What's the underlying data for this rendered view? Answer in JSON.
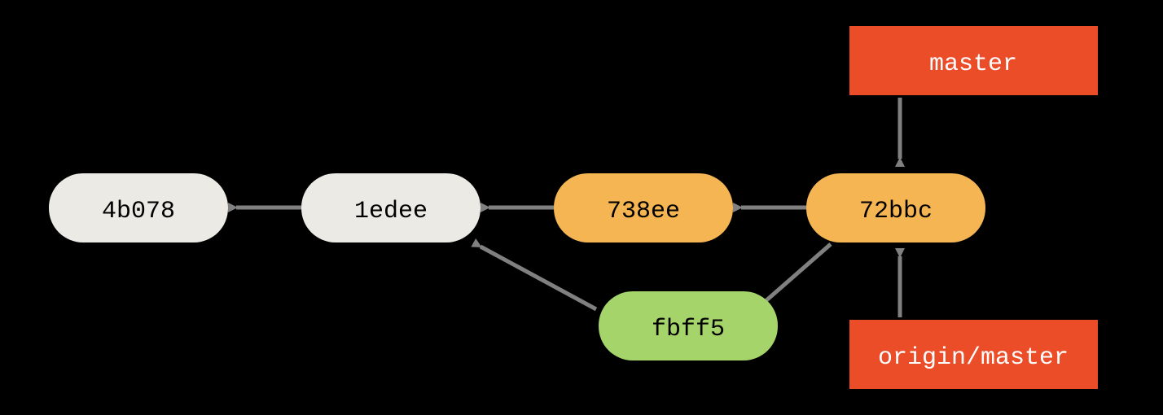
{
  "colors": {
    "commit_old": "#ECEAE4",
    "commit_mid": "#F4B552",
    "commit_new": "#A4D46A",
    "branch": "#EB4D28",
    "arrow": "#808080",
    "background": "#000000"
  },
  "commits": {
    "c1": {
      "label": "4b078"
    },
    "c2": {
      "label": "1edee"
    },
    "c3": {
      "label": "738ee"
    },
    "c4": {
      "label": "72bbc"
    },
    "c5": {
      "label": "fbff5"
    }
  },
  "branches": {
    "master": {
      "label": "master"
    },
    "origin_master": {
      "label": "origin/master"
    }
  },
  "layout_notes": "Git commit graph. Arrows point from child to parent (older). 72bbc is a merge commit with parents 738ee and fbff5. fbff5 has parent 1edee. 738ee has parent 1edee. 1edee has parent 4b078. master and origin/master both point to 72bbc."
}
